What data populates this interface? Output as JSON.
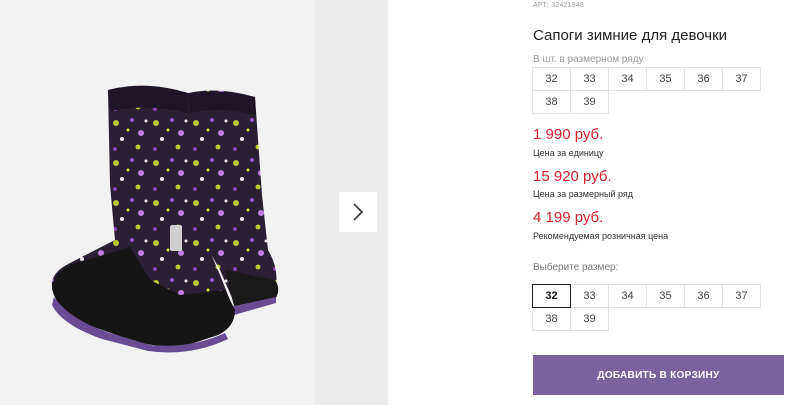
{
  "product": {
    "article": "АРТ: 32421948",
    "title": "Сапоги зимние для девочки",
    "image_alt": "boots-photo"
  },
  "row_sizes": {
    "label": "В шт. в размерном ряду",
    "sizes": [
      "32",
      "33",
      "34",
      "35",
      "36",
      "37",
      "38",
      "39"
    ]
  },
  "prices": {
    "unit_price": "1 990 руб.",
    "unit_note": "Цена за единицу",
    "row_price": "15 920 руб.",
    "row_note": "Цена за размерный ряд",
    "retail_price": "4 199 руб.",
    "retail_note": "Рекомендуемая розничная цена"
  },
  "size_select": {
    "label": "Выберите размер:",
    "sizes": [
      "32",
      "33",
      "34",
      "35",
      "36",
      "37",
      "38",
      "39"
    ],
    "selected": "32"
  },
  "cart": {
    "label": "ДОБАВИТЬ В КОРЗИНУ"
  },
  "colors": {
    "price_red": "#d3212e",
    "button_purple": "#7a639c",
    "gallery_bg": "#f0f0f0"
  },
  "icons": {
    "next": "chevron-right-icon"
  }
}
